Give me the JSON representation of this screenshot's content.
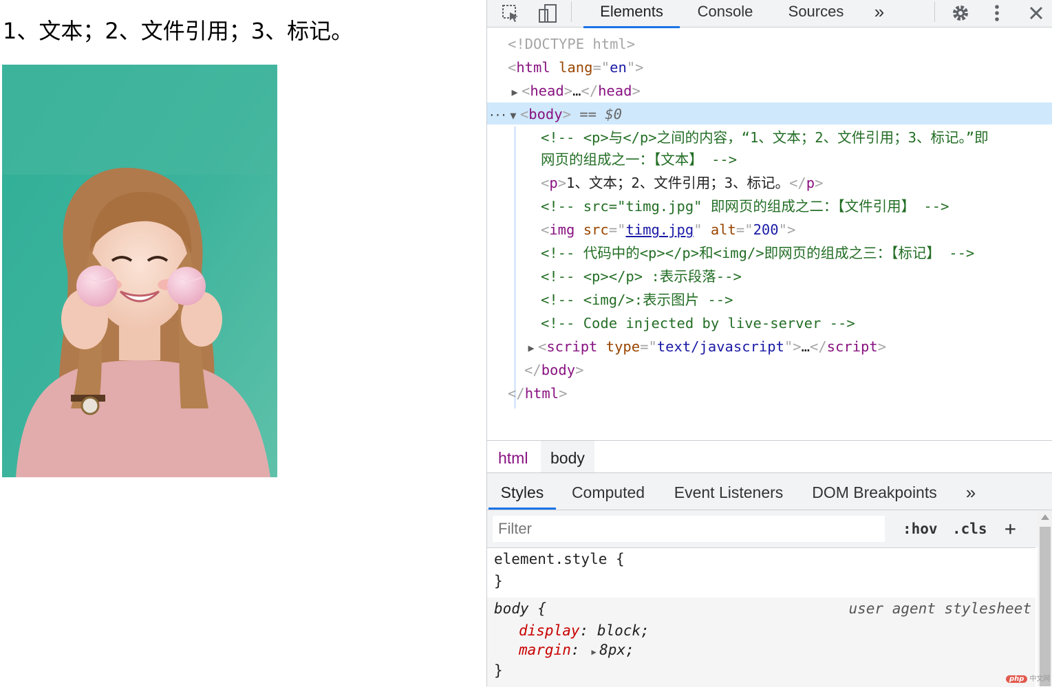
{
  "page": {
    "paragraph": "1、文本；2、文件引用；3、标记。",
    "image_alt": "200"
  },
  "devtools": {
    "toolbar": {
      "tabs": [
        "Elements",
        "Console",
        "Sources"
      ],
      "active_tab": "Elements",
      "more": "»",
      "icons": [
        "inspect-icon",
        "device-toggle-icon",
        "gear-icon",
        "kebab-menu-icon",
        "close-icon"
      ]
    },
    "tree": {
      "doctype": "<!DOCTYPE html>",
      "html_open": {
        "tag": "html",
        "attr": "lang",
        "val": "en"
      },
      "head": {
        "tag": "head",
        "ellipsis": "…"
      },
      "body": {
        "tag": "body",
        "eq": "== $0",
        "dots": "···"
      },
      "comment1a": "<!-- <p>与</p>之间的内容，“1、文本；2、文件引用；3、标记。”即",
      "comment1b": "网页的组成之一：【文本】 -->",
      "p_text": "1、文本；2、文件引用；3、标记。",
      "comment2": "<!-- src=\"timg.jpg\" 即网页的组成之二：【文件引用】 -->",
      "img": {
        "tag": "img",
        "src_attr": "src",
        "src": "timg.jpg",
        "alt_attr": "alt",
        "alt": "200"
      },
      "comment3": "<!-- 代码中的<p></p>和<img/>即网页的组成之三：【标记】 -->",
      "comment4": "<!-- <p></p> :表示段落-->",
      "comment5": "<!-- <img/>:表示图片 -->",
      "comment6": "<!-- Code injected by live-server -->",
      "script": {
        "tag": "script",
        "attr": "type",
        "val": "text/javascript",
        "ellipsis": "…"
      },
      "body_close": "body",
      "html_close": "html"
    },
    "breadcrumbs": [
      "html",
      "body"
    ],
    "lower_tabs": [
      "Styles",
      "Computed",
      "Event Listeners",
      "DOM Breakpoints"
    ],
    "lower_active": "Styles",
    "lower_more": "»",
    "filter": {
      "placeholder": "Filter",
      "hov": ":hov",
      "cls": ".cls",
      "add": "+"
    },
    "styles": {
      "element_style_open": "element.style {",
      "close": "}",
      "body_selector": "body",
      "open_brace": "{",
      "source": "user agent stylesheet",
      "props": [
        {
          "name": "display",
          "value": "block"
        },
        {
          "name": "margin",
          "value": "8px"
        }
      ]
    }
  },
  "watermark": {
    "badge": "php",
    "text": "中文网"
  },
  "colors": {
    "accent": "#1a73e8",
    "selection": "#cfe8fc",
    "tag": "#881280",
    "comment": "#236e25"
  }
}
